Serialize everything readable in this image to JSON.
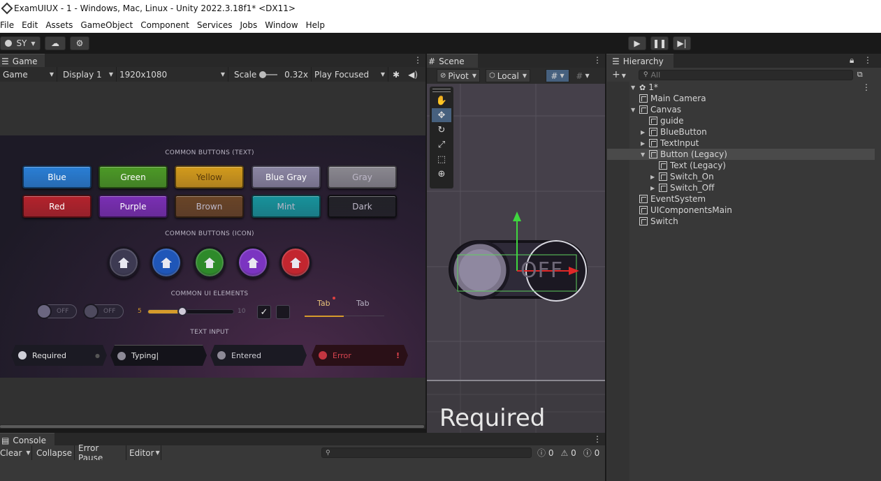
{
  "window": {
    "title": "ExamUIUX - 1 - Windows, Mac, Linux - Unity 2022.3.18f1* <DX11>"
  },
  "menu": [
    "File",
    "Edit",
    "Assets",
    "GameObject",
    "Component",
    "Services",
    "Jobs",
    "Window",
    "Help"
  ],
  "toolbar": {
    "account": "SY"
  },
  "game": {
    "tab": "Game",
    "view_mode": "Game",
    "display": "Display 1",
    "resolution": "1920x1080",
    "scale_label": "Scale",
    "scale_value": "0.32x",
    "play_mode": "Play Focused",
    "sections": {
      "text_buttons": "COMMON BUTTONS (TEXT)",
      "icon_buttons": "COMMON BUTTONS (ICON)",
      "ui_elements": "COMMON UI ELEMENTS",
      "text_input": "TEXT INPUT"
    },
    "text_buttons": [
      {
        "label": "Blue",
        "color": "#2a7fd6"
      },
      {
        "label": "Green",
        "color": "#4c9a26"
      },
      {
        "label": "Yellow",
        "color": "#d39b1c"
      },
      {
        "label": "Blue Gray",
        "color": "#8b86a3"
      },
      {
        "label": "Gray",
        "color": "#8a8890"
      },
      {
        "label": "Red",
        "color": "#b4232c"
      },
      {
        "label": "Purple",
        "color": "#7a2fb4"
      },
      {
        "label": "Brown",
        "color": "#6a4527"
      },
      {
        "label": "Mint",
        "color": "#17939b"
      },
      {
        "label": "Dark",
        "color": "#222228"
      }
    ],
    "icon_buttons": [
      {
        "icon": "home-icon",
        "color": "#3d3a52"
      },
      {
        "icon": "home-icon",
        "color": "#1f56b8"
      },
      {
        "icon": "home-icon",
        "color": "#2e8a2a"
      },
      {
        "icon": "home-icon",
        "color": "#7b34c1"
      },
      {
        "icon": "home-icon",
        "color": "#c2262f"
      }
    ],
    "switches": [
      "OFF",
      "OFF"
    ],
    "slider": {
      "min": "5",
      "max": "10",
      "value": 7
    },
    "tabs": [
      "Tab",
      "Tab"
    ],
    "inputs": [
      {
        "text": "Required",
        "state": "required"
      },
      {
        "text": "Typing",
        "state": "typing"
      },
      {
        "text": "Entered",
        "state": "entered"
      },
      {
        "text": "Error",
        "state": "error",
        "mark": "!"
      }
    ]
  },
  "scene": {
    "tab": "Scene",
    "pivot": "Pivot",
    "space": "Local",
    "switch_label": "OFF",
    "overlay_text": "Required"
  },
  "hierarchy": {
    "tab": "Hierarchy",
    "search_placeholder": "All",
    "scene_name": "1*",
    "items": [
      {
        "label": "Main Camera",
        "depth": 1,
        "arrow": ""
      },
      {
        "label": "Canvas",
        "depth": 1,
        "arrow": "open"
      },
      {
        "label": "guide",
        "depth": 2,
        "arrow": ""
      },
      {
        "label": "BlueButton",
        "depth": 2,
        "arrow": "closed"
      },
      {
        "label": "TextInput",
        "depth": 2,
        "arrow": "closed"
      },
      {
        "label": "Button (Legacy)",
        "depth": 2,
        "arrow": "open",
        "selected": true
      },
      {
        "label": "Text (Legacy)",
        "depth": 3,
        "arrow": ""
      },
      {
        "label": "Switch_On",
        "depth": 3,
        "arrow": "closed"
      },
      {
        "label": "Switch_Off",
        "depth": 3,
        "arrow": "closed"
      },
      {
        "label": "EventSystem",
        "depth": 1,
        "arrow": ""
      },
      {
        "label": "UIComponentsMain",
        "depth": 1,
        "arrow": ""
      },
      {
        "label": "Switch",
        "depth": 1,
        "arrow": ""
      }
    ]
  },
  "console": {
    "tab": "Console",
    "clear": "Clear",
    "collapse": "Collapse",
    "error_pause": "Error Pause",
    "editor": "Editor",
    "log_count": "0",
    "warn_count": "0",
    "error_count": "0"
  }
}
